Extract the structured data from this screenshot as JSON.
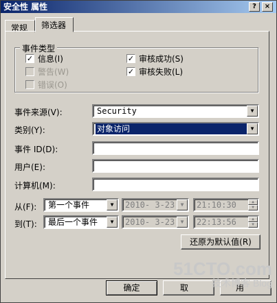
{
  "window": {
    "title": "安全性 属性",
    "help_btn": "?",
    "close_btn": "×"
  },
  "tabs": [
    {
      "label": "常规",
      "active": false
    },
    {
      "label": "筛选器",
      "active": true
    }
  ],
  "event_types": {
    "title": "事件类型",
    "information": {
      "label": "信息(I)",
      "checked": true,
      "enabled": true
    },
    "warning": {
      "label": "警告(W)",
      "checked": false,
      "enabled": false
    },
    "error": {
      "label": "错误(O)",
      "checked": false,
      "enabled": false
    },
    "audit_success": {
      "label": "审核成功(S)",
      "checked": true,
      "enabled": true
    },
    "audit_failure": {
      "label": "审核失败(L)",
      "checked": true,
      "enabled": true
    }
  },
  "fields": {
    "source_label": "事件来源(V):",
    "source_value": "Security",
    "category_label": "类别(Y):",
    "category_value": "对象访问",
    "event_id_label": "事件 ID(D):",
    "event_id_value": "",
    "user_label": "用户(E):",
    "user_value": "",
    "computer_label": "计算机(M):",
    "computer_value": ""
  },
  "range": {
    "from_label": "从(F):",
    "from_select": "第一个事件",
    "from_date": "2010- 3-23",
    "from_time": "21:10:30",
    "to_label": "到(T):",
    "to_select": "最后一个事件",
    "to_date": "2010- 3-23",
    "to_time": "22:13:56"
  },
  "buttons": {
    "restore_defaults": "还原为默认值(R)",
    "ok": "确定",
    "cancel": "取",
    "apply": "用"
  },
  "watermark": {
    "main": "51CTO.com",
    "sub": "技术博客 Blog"
  },
  "icons": {
    "dropdown": "chevron-down-icon",
    "check": "check-icon"
  }
}
